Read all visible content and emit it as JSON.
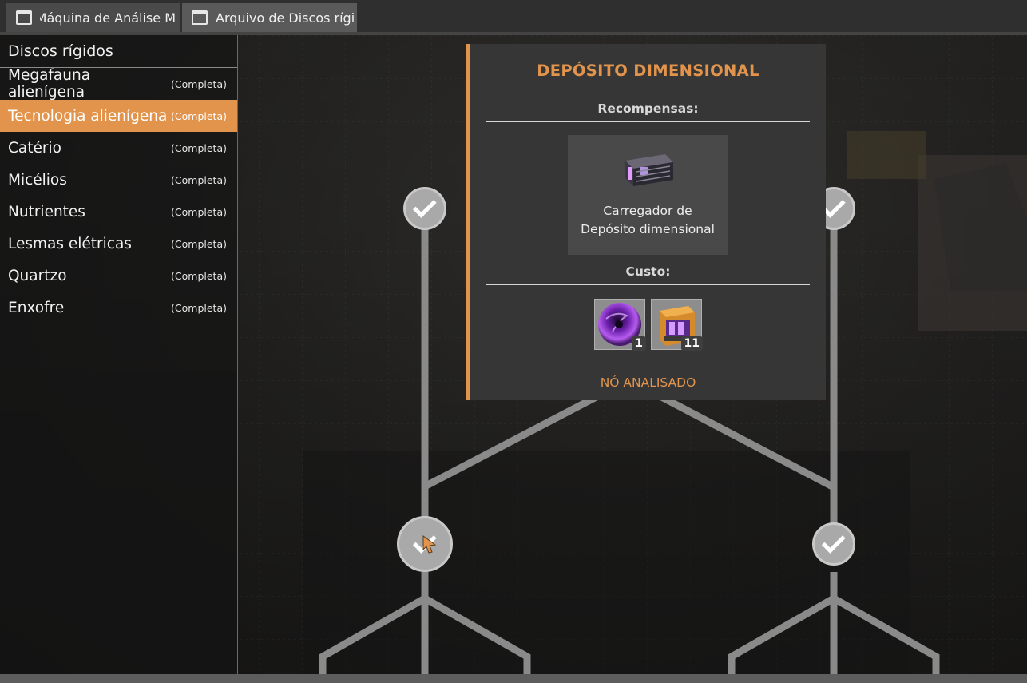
{
  "tabs": [
    {
      "label": "Máquina de Análise M"
    },
    {
      "label": "Arquivo de Discos rígi"
    }
  ],
  "sidebar": {
    "header": "Discos rígidos",
    "items": [
      {
        "name": "Megafauna alienígena",
        "status": "(Completa)"
      },
      {
        "name": "Tecnologia alienígena",
        "status": "(Completa)",
        "active": true
      },
      {
        "name": "Catério",
        "status": "(Completa)"
      },
      {
        "name": "Micélios",
        "status": "(Completa)"
      },
      {
        "name": "Nutrientes",
        "status": "(Completa)"
      },
      {
        "name": "Lesmas elétricas",
        "status": "(Completa)"
      },
      {
        "name": "Quartzo",
        "status": "(Completa)"
      },
      {
        "name": "Enxofre",
        "status": "(Completa)"
      }
    ]
  },
  "panel": {
    "title": "DEPÓSITO DIMENSIONAL",
    "rewards_label": "Recompensas:",
    "reward": {
      "name_line1": "Carregador de",
      "name_line2": "Depósito dimensional",
      "icon": "dimensional-depot-uploader-icon"
    },
    "cost_label": "Custo:",
    "costs": [
      {
        "icon": "dark-matter-sphere-icon",
        "count": "1"
      },
      {
        "icon": "ficsit-container-icon",
        "count": "11"
      }
    ],
    "status": "NÓ ANALISADO"
  },
  "colors": {
    "accent": "#e2944c",
    "panel_bg": "#363636",
    "node_fill": "#a9a9a9"
  }
}
